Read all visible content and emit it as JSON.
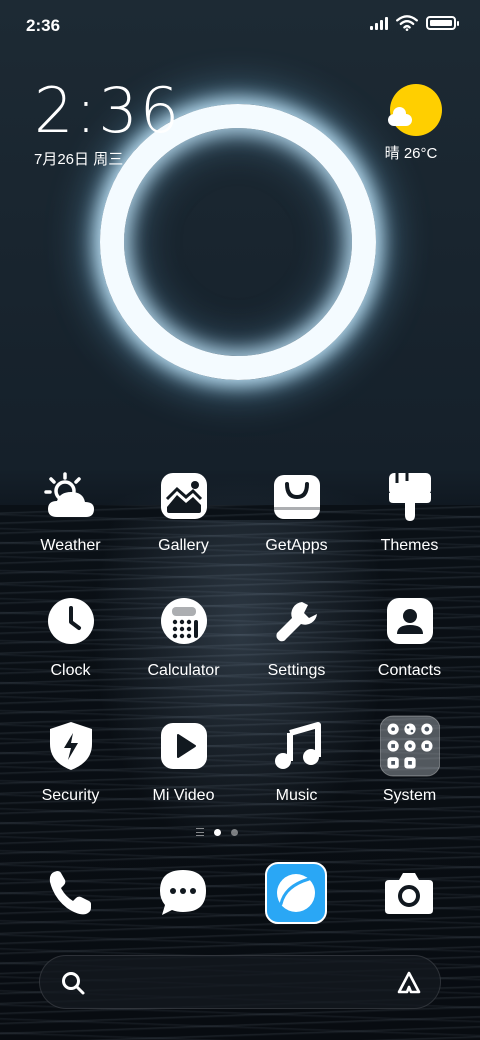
{
  "status_bar": {
    "time": "2:36",
    "icons": [
      "signal-icon",
      "wifi-icon",
      "battery-icon"
    ]
  },
  "clock_widget": {
    "time": "2:36",
    "date": "7月26日 周三"
  },
  "weather_widget": {
    "condition_icon": "partly-sunny-icon",
    "text": "晴 26°C"
  },
  "apps": [
    {
      "label": "Weather",
      "icon": "weather-icon"
    },
    {
      "label": "Gallery",
      "icon": "gallery-icon"
    },
    {
      "label": "GetApps",
      "icon": "getapps-icon"
    },
    {
      "label": "Themes",
      "icon": "themes-icon"
    },
    {
      "label": "Clock",
      "icon": "clock-icon"
    },
    {
      "label": "Calculator",
      "icon": "calculator-icon"
    },
    {
      "label": "Settings",
      "icon": "settings-icon"
    },
    {
      "label": "Contacts",
      "icon": "contacts-icon"
    },
    {
      "label": "Security",
      "icon": "security-icon"
    },
    {
      "label": "Mi Video",
      "icon": "mi-video-icon"
    },
    {
      "label": "Music",
      "icon": "music-icon"
    },
    {
      "label": "System",
      "icon": "system-folder-icon"
    }
  ],
  "page_indicator": {
    "pages": 2,
    "current": 1
  },
  "dock": [
    {
      "name": "phone",
      "icon": "phone-icon"
    },
    {
      "name": "messaging",
      "icon": "message-icon"
    },
    {
      "name": "browser",
      "icon": "browser-icon",
      "accent": "#2aa7f5"
    },
    {
      "name": "camera",
      "icon": "camera-icon"
    }
  ],
  "search_bar": {
    "left_icon": "search-icon",
    "right_icon": "assistant-icon"
  },
  "colors": {
    "sun": "#ffcf00",
    "ring": "#f4fbff",
    "browser": "#2aa7f5"
  }
}
